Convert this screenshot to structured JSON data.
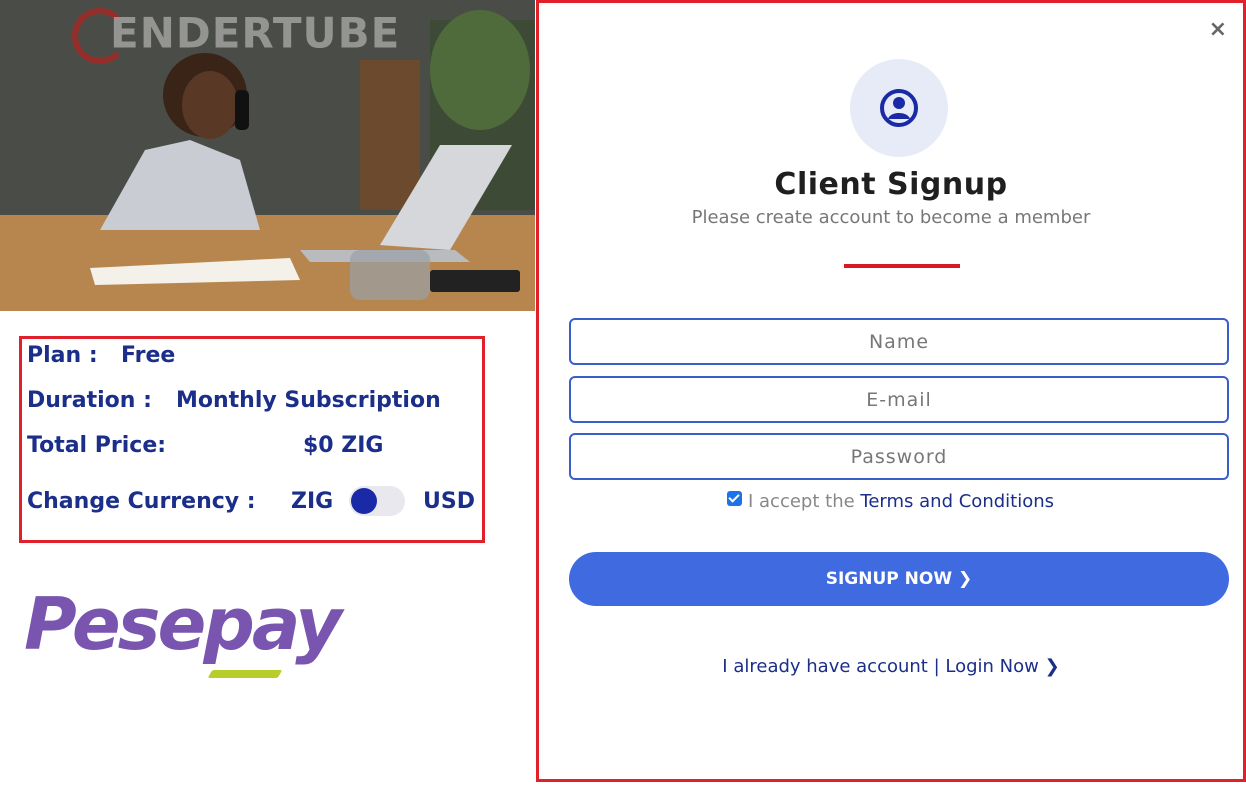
{
  "hero": {
    "watermark_text": "ENDERTUBE"
  },
  "plan": {
    "plan_label": "Plan :",
    "plan_value": "Free",
    "duration_label": "Duration :",
    "duration_value": "Monthly Subscription",
    "total_label": "Total Price:",
    "total_value": "$0 ZIG",
    "currency_label": "Change Currency :",
    "currency_left": "ZIG",
    "currency_right": "USD",
    "currency_selected": "ZIG"
  },
  "payment_logo": "Pesepay",
  "modal": {
    "close_label": "×",
    "title": "Client Signup",
    "subtitle": "Please create account to become a member",
    "name_placeholder": "Name",
    "email_placeholder": "E-mail",
    "password_placeholder": "Password",
    "terms_prefix": "I accept the",
    "terms_link": "Terms and Conditions",
    "terms_checked": true,
    "signup_label": "SIGNUP NOW ❯",
    "login_prefix": "I already have account |",
    "login_link": "Login Now ❯"
  },
  "colors": {
    "accent_red": "#e0202a",
    "navy_text": "#1a2e8a",
    "button_blue": "#3f6ae0",
    "logo_purple": "#7a55b0"
  }
}
